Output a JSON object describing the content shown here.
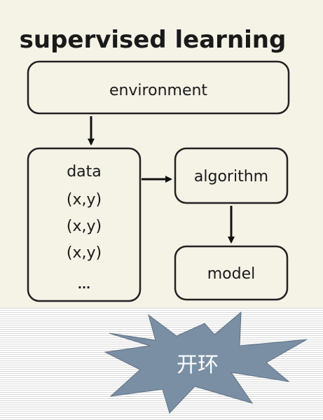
{
  "diagram": {
    "title": "supervised learning",
    "nodes": {
      "environment": "environment",
      "data": {
        "label": "data",
        "rows": [
          "(x,y)",
          "(x,y)",
          "(x,y)",
          "..."
        ]
      },
      "algorithm": "algorithm",
      "model": "model"
    },
    "edges": [
      {
        "from": "environment",
        "to": "data"
      },
      {
        "from": "data",
        "to": "algorithm"
      },
      {
        "from": "algorithm",
        "to": "model"
      }
    ]
  },
  "callout": {
    "text": "开环",
    "fill": "#7a8fa4",
    "text_color": "#ffffff"
  }
}
